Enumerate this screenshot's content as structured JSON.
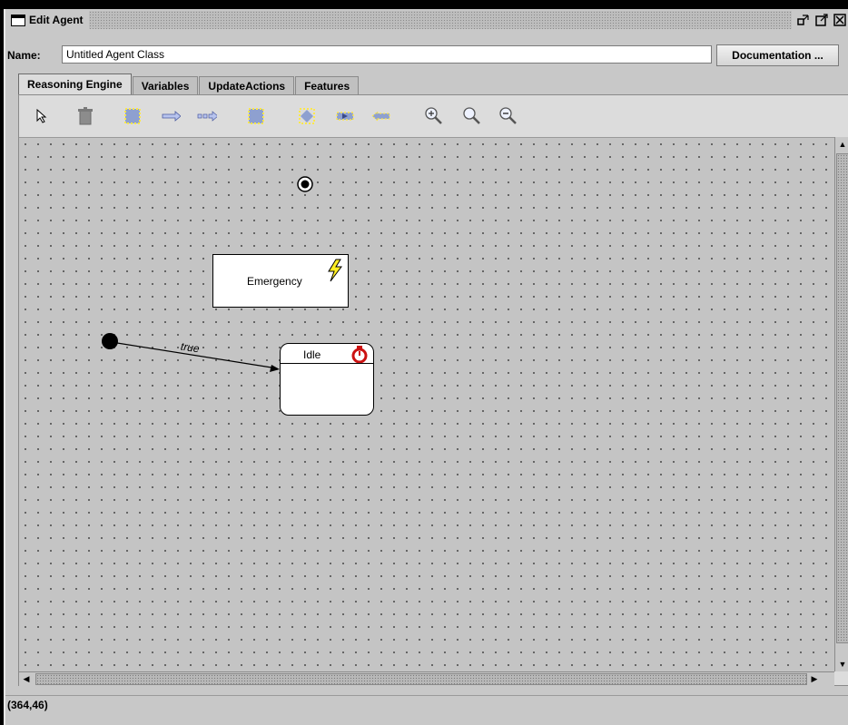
{
  "window": {
    "title": "Edit Agent"
  },
  "name_row": {
    "label": "Name:",
    "value": "Untitled Agent Class",
    "doc_button": "Documentation ..."
  },
  "tabs": [
    {
      "label": "Reasoning Engine",
      "active": true
    },
    {
      "label": "Variables",
      "active": false
    },
    {
      "label": "UpdateActions",
      "active": false
    },
    {
      "label": "Features",
      "active": false
    }
  ],
  "toolbar": {
    "tools": [
      "select-icon",
      "delete-icon",
      "state-icon",
      "transition-icon",
      "dashed-transition-icon",
      "state-icon-2",
      "decision-icon",
      "send-icon",
      "receive-icon",
      "zoom-in-icon",
      "zoom-reset-icon",
      "zoom-out-icon"
    ]
  },
  "diagram": {
    "states": [
      {
        "label": "Emergency",
        "icon": "lightning-icon"
      },
      {
        "label": "Idle",
        "icon": "timer-icon"
      }
    ],
    "transition": {
      "label": "true"
    }
  },
  "status": {
    "coords": "(364,46)"
  },
  "colors": {
    "canvas": "#c4c4c4",
    "timer_red": "#cc1111",
    "lightning_yellow": "#ffee22"
  }
}
